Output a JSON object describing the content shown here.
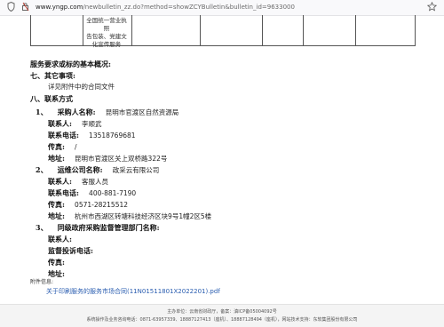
{
  "browser": {
    "url_prefix": "www.yngp.com",
    "url_rest": "/newbulletin_zz.do?method=showZCYBulletin&bulletin_id=9633000"
  },
  "table_fragment": {
    "cell_lines": [
      "全国统一营业执照",
      "告包装、党建文",
      "化宣传服务"
    ]
  },
  "section": {
    "basic_heading": "服务要求或标的基本概况:",
    "other_heading": "七、其它事项:",
    "other_body": "详见附件中的合同文件",
    "contact_heading": "八、联系方式"
  },
  "contacts": {
    "purchaser": {
      "heading_num": "1、",
      "heading_label": "采购人名称:",
      "heading_value": "昆明市官渡区自然资源局",
      "contact_label": "联系人:",
      "contact_value": "李顺武",
      "phone_label": "联系电话:",
      "phone_value": "13518769681",
      "fax_label": "传真:",
      "fax_value": "/",
      "addr_label": "地址:",
      "addr_value": "昆明市官渡区关上双桥路322号"
    },
    "operator": {
      "heading_num": "2、",
      "heading_label": "运维公司名称:",
      "heading_value": "政采云有限公司",
      "contact_label": "联系人:",
      "contact_value": "客服人员",
      "phone_label": "联系电话:",
      "phone_value": "400-881-7190",
      "fax_label": "传真:",
      "fax_value": "0571-28215512",
      "addr_label": "地址:",
      "addr_value": "杭州市西湖区转塘科技经济区块9号1幢2区5楼"
    },
    "supervisor": {
      "heading_num": "3、",
      "heading_label": "同级政府采购监督管理部门名称:",
      "contact_label": "联系人:",
      "phone_label": "监督投诉电话:",
      "fax_label": "传真:",
      "addr_label": "地址:"
    }
  },
  "attachments": {
    "label": "附件信息:",
    "file_link": "关于印刷服务的服务市场合同(11N01511801X2022201).pdf"
  },
  "footer": {
    "line1": "主办单位：云南省财政厅，备案：滇ICP备05004092号",
    "line2": "系统操作及业务咨询电话：0871-63957339、18887127413（座机）、18887128494（座机），网站技术支持：东软集团股份有限公司"
  },
  "icons": {
    "shield": "shield-icon",
    "lock": "lock-icon",
    "star": "bookmark-star-icon"
  },
  "colors": {
    "link": "#2a5db0"
  }
}
